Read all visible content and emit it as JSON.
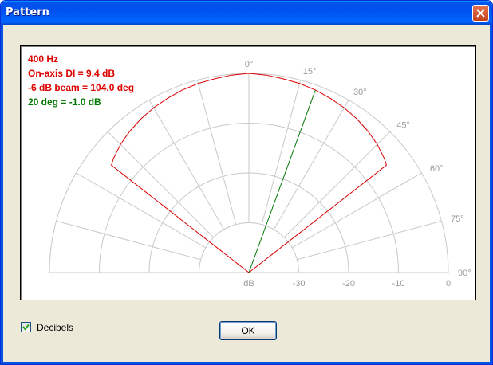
{
  "window": {
    "title": "Pattern"
  },
  "info": {
    "frequency": "400 Hz",
    "di": "On-axis DI = 9.4 dB",
    "beam": "-6 dB beam = 104.0 deg",
    "cursor": "20 deg = -1.0 dB"
  },
  "controls": {
    "decibels_label": "Decibels",
    "decibels_checked": true,
    "ok_label": "OK"
  },
  "colors": {
    "pattern": "#dd0000",
    "cursor": "#007700",
    "grid": "#c8c8c8",
    "angle_labels": "#999999"
  },
  "chart_data": {
    "type": "polar",
    "angle_ticks": [
      "0°",
      "15°",
      "30°",
      "45°",
      "60°",
      "75°",
      "90°"
    ],
    "radial_tick_labels": [
      "dB",
      "-30",
      "-20",
      "-10",
      "0"
    ],
    "radial_range_db": [
      -40,
      0
    ],
    "pattern_series": {
      "angles_deg": [
        0,
        5,
        10,
        15,
        20,
        25,
        30,
        35,
        40,
        45,
        50,
        52
      ],
      "values_db": [
        0,
        -0.2,
        -0.5,
        -0.7,
        -1.0,
        -1.4,
        -1.8,
        -2.3,
        -2.9,
        -3.6,
        -4.5,
        -5.0
      ]
    },
    "cursor_line": {
      "angle_deg": 20,
      "value_db": -1.0
    }
  }
}
